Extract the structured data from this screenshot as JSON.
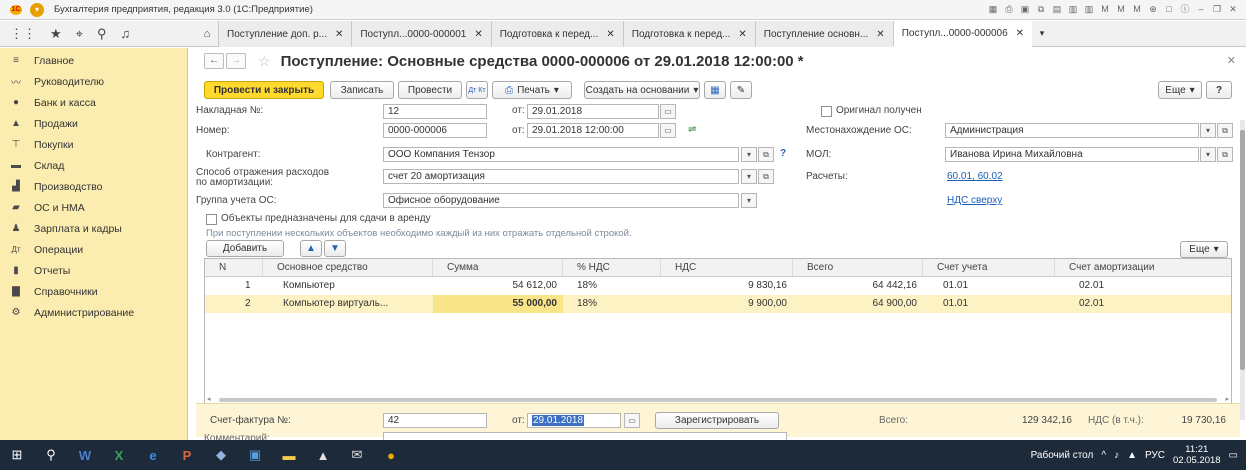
{
  "window": {
    "title": "Бухгалтерия предприятия, редакция 3.0 (1С:Предприятие)"
  },
  "tabs": [
    {
      "label": "Поступление доп. р...",
      "active": false
    },
    {
      "label": "Поступл...0000-000001",
      "active": false
    },
    {
      "label": "Подготовка к перед...",
      "active": false
    },
    {
      "label": "Подготовка к перед...",
      "active": false
    },
    {
      "label": "Поступление основн...",
      "active": false
    },
    {
      "label": "Поступл...0000-000006",
      "active": true
    }
  ],
  "sidebar": {
    "items": [
      {
        "label": "Главное",
        "icon": "menu-icon"
      },
      {
        "label": "Руководителю",
        "icon": "chart-line-icon"
      },
      {
        "label": "Банк и касса",
        "icon": "bank-icon"
      },
      {
        "label": "Продажи",
        "icon": "sales-icon"
      },
      {
        "label": "Покупки",
        "icon": "cart-icon"
      },
      {
        "label": "Склад",
        "icon": "warehouse-icon"
      },
      {
        "label": "Производство",
        "icon": "factory-icon"
      },
      {
        "label": "ОС и НМА",
        "icon": "truck-icon"
      },
      {
        "label": "Зарплата и кадры",
        "icon": "person-icon"
      },
      {
        "label": "Операции",
        "icon": "operations-icon"
      },
      {
        "label": "Отчеты",
        "icon": "bar-chart-icon"
      },
      {
        "label": "Справочники",
        "icon": "book-icon"
      },
      {
        "label": "Администрирование",
        "icon": "gear-icon"
      }
    ]
  },
  "document": {
    "title": "Поступление: Основные средства 0000-000006 от 29.01.2018 12:00:00 *"
  },
  "toolbar": {
    "post_close": "Провести и закрыть",
    "save": "Записать",
    "post": "Провести",
    "dtkt": "Дт Кт",
    "print": "Печать",
    "create_based": "Создать на основании",
    "more": "Еще",
    "help": "?"
  },
  "form": {
    "invoice_no_label": "Накладная №:",
    "invoice_no": "12",
    "from_label": "от:",
    "invoice_date": "29.01.2018",
    "original_label": "Оригинал получен",
    "number_label": "Номер:",
    "number": "0000-000006",
    "number_date": "29.01.2018 12:00:00",
    "location_label": "Местонахождение ОС:",
    "location": "Администрация",
    "counterparty_label": "Контрагент:",
    "counterparty": "ООО Компания Тензор",
    "mol_label": "МОЛ:",
    "mol": "Иванова Ирина Михайловна",
    "expense_label_1": "Способ отражения расходов",
    "expense_label_2": "по амортизации:",
    "expense": "счет 20 амортизация",
    "settlements_label": "Расчеты:",
    "settlements_link": "60.01, 60.02",
    "group_label": "Группа учета ОС:",
    "group": "Офисное оборудование",
    "vat_link": "НДС сверху",
    "rent_label": "Объекты предназначены для сдачи в аренду",
    "hint": "При поступлении нескольких объектов необходимо каждый из них отражать отдельной строкой."
  },
  "table": {
    "add_label": "Добавить",
    "more_label": "Еще",
    "columns": [
      "N",
      "Основное средство",
      "Сумма",
      "% НДС",
      "НДС",
      "Всего",
      "Счет учета",
      "Счет амортизации"
    ],
    "rows": [
      {
        "n": "1",
        "asset": "Компьютер",
        "sum": "54 612,00",
        "vat_rate": "18%",
        "vat": "9 830,16",
        "total": "64 442,16",
        "account": "01.01",
        "amort": "02.01",
        "selected": false
      },
      {
        "n": "2",
        "asset": "Компьютер виртуаль...",
        "sum": "55 000,00",
        "vat_rate": "18%",
        "vat": "9 900,00",
        "total": "64 900,00",
        "account": "01.01",
        "amort": "02.01",
        "selected": true
      }
    ]
  },
  "footer": {
    "sf_label": "Счет-фактура №:",
    "sf_no": "42",
    "from_label": "от:",
    "sf_date": "29.01.2018",
    "register": "Зарегистрировать",
    "total_label": "Всего:",
    "total": "129 342,16",
    "vat_label": "НДС (в т.ч.):",
    "vat_total": "19 730,16",
    "comment_label": "Комментарий:"
  },
  "taskbar": {
    "desktop": "Рабочий стол",
    "lang": "РУС",
    "time": "11:21",
    "date": "02.05.2018"
  },
  "colors": {
    "sidebar_bg": "#fbedb0",
    "primary_button": "#ffd92e",
    "link": "#1f5fb6",
    "selected_row": "#fdf2c4",
    "taskbar": "#1c2a3a"
  }
}
